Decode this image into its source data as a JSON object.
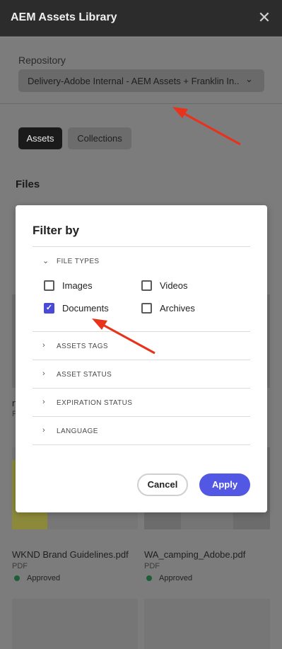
{
  "window": {
    "title": "AEM Assets Library",
    "close_icon": "close-icon"
  },
  "repository": {
    "label": "Repository",
    "selected": "Delivery-Adobe Internal - AEM Assets + Franklin In..."
  },
  "tabs": [
    {
      "label": "Assets",
      "active": true
    },
    {
      "label": "Collections",
      "active": false
    }
  ],
  "files_heading": "Files",
  "background_cards": [
    {
      "prefix": "n",
      "sub": "P"
    },
    {
      "name": "WKND Brand Guidelines.pdf",
      "type": "PDF",
      "status": "Approved"
    },
    {
      "name": "WA_camping_Adobe.pdf",
      "type": "PDF",
      "status": "Approved"
    }
  ],
  "filter": {
    "title": "Filter by",
    "file_types": {
      "label": "FILE TYPES",
      "options": [
        {
          "label": "Images",
          "checked": false
        },
        {
          "label": "Videos",
          "checked": false
        },
        {
          "label": "Documents",
          "checked": true
        },
        {
          "label": "Archives",
          "checked": false
        }
      ]
    },
    "sections": [
      "ASSETS TAGS",
      "ASSET STATUS",
      "EXPIRATION STATUS",
      "LANGUAGE"
    ],
    "cancel_label": "Cancel",
    "apply_label": "Apply"
  },
  "colors": {
    "accent": "#5258e4",
    "annotation_arrow": "#e8321c",
    "status_approved": "#1c5e37"
  }
}
